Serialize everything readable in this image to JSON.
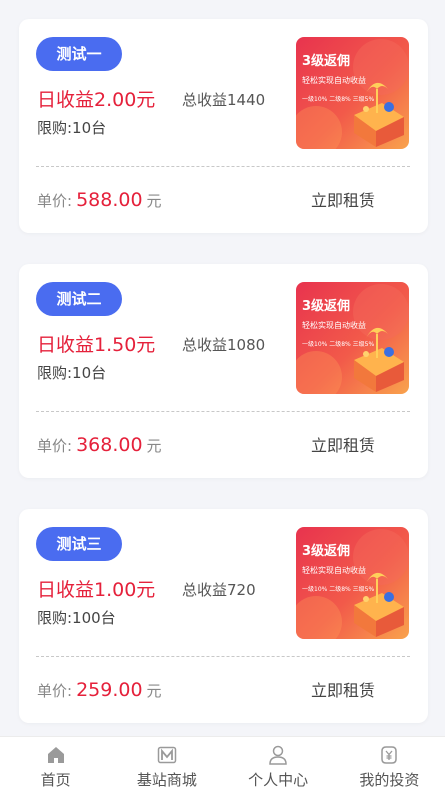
{
  "products": [
    {
      "badge": "测试一",
      "daily_income": "日收益2.00元",
      "total_income": "总收益1440",
      "limit": "限购:10台",
      "price_label": "单价:",
      "price": "588.00",
      "price_unit": "元",
      "action": "立即租赁",
      "image": {
        "headline": "3级返佣",
        "subline": "轻松实现自动收益",
        "tiers": "一级10%  二级8%  三级5%"
      }
    },
    {
      "badge": "测试二",
      "daily_income": "日收益1.50元",
      "total_income": "总收益1080",
      "limit": "限购:10台",
      "price_label": "单价:",
      "price": "368.00",
      "price_unit": "元",
      "action": "立即租赁",
      "image": {
        "headline": "3级返佣",
        "subline": "轻松实现自动收益",
        "tiers": "一级10%  二级8%  三级5%"
      }
    },
    {
      "badge": "测试三",
      "daily_income": "日收益1.00元",
      "total_income": "总收益720",
      "limit": "限购:100台",
      "price_label": "单价:",
      "price": "259.00",
      "price_unit": "元",
      "action": "立即租赁",
      "image": {
        "headline": "3级返佣",
        "subline": "轻松实现自动收益",
        "tiers": "一级10%  二级8%  三级5%"
      }
    }
  ],
  "tabbar": [
    {
      "label": "首页",
      "icon": "home-icon"
    },
    {
      "label": "基站商城",
      "icon": "mall-icon"
    },
    {
      "label": "个人中心",
      "icon": "user-icon"
    },
    {
      "label": "我的投资",
      "icon": "investment-icon"
    }
  ],
  "colors": {
    "accent_blue": "#4a6cf0",
    "price_red": "#e5213b",
    "background": "#f4f5f9"
  }
}
